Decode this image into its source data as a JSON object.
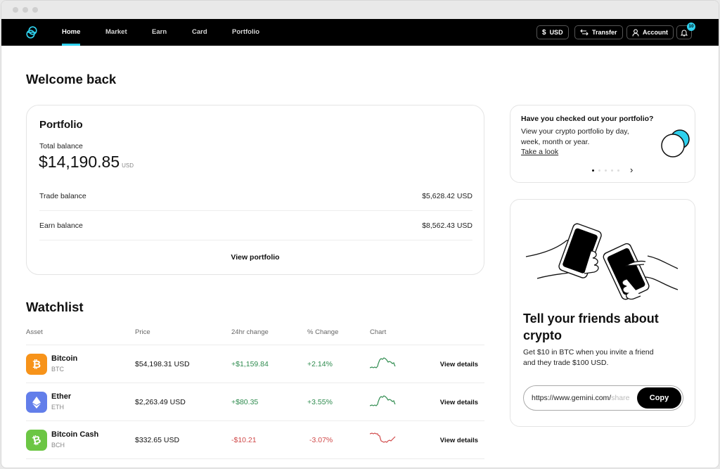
{
  "nav": {
    "logo": "gemini-logo-icon",
    "tabs": [
      {
        "label": "Home",
        "active": true
      },
      {
        "label": "Market",
        "active": false
      },
      {
        "label": "Earn",
        "active": false
      },
      {
        "label": "Card",
        "active": false
      },
      {
        "label": "Portfolio",
        "active": false
      }
    ],
    "currency_label": "USD",
    "transfer_label": "Transfer",
    "account_label": "Account",
    "notification_count": "10",
    "accent_color": "#2fd1ee"
  },
  "welcome": "Welcome back",
  "portfolio": {
    "title": "Portfolio",
    "total_label": "Total balance",
    "total_value": "$14,190.85",
    "total_unit": "USD",
    "rows": [
      {
        "label": "Trade balance",
        "value": "$5,628.42 USD"
      },
      {
        "label": "Earn balance",
        "value": "$8,562.43 USD"
      }
    ],
    "view_label": "View portfolio"
  },
  "watchlist": {
    "title": "Watchlist",
    "columns": [
      "Asset",
      "Price",
      "24hr change",
      "% Change",
      "Chart"
    ],
    "rows": [
      {
        "name": "Bitcoin",
        "symbol": "BTC",
        "icon": "bitcoin-icon",
        "icon_color": "#f7931a",
        "price": "$54,198.31 USD",
        "change": "+$1,159.84",
        "pct": "+2.14%",
        "trend": "up",
        "action": "View details"
      },
      {
        "name": "Ether",
        "symbol": "ETH",
        "icon": "ether-icon",
        "icon_color": "#627eea",
        "price": "$2,263.49 USD",
        "change": "+$80.35",
        "pct": "+3.55%",
        "trend": "up",
        "action": "View details"
      },
      {
        "name": "Bitcoin Cash",
        "symbol": "BCH",
        "icon": "bitcoin-cash-icon",
        "icon_color": "#6cc644",
        "price": "$332.65 USD",
        "change": "-$10.21",
        "pct": "-3.07%",
        "trend": "down",
        "action": "View details"
      }
    ],
    "positive_color": "#2e8b4e",
    "negative_color": "#d04848"
  },
  "promo": {
    "title": "Have you checked out your portfolio?",
    "text": "View your crypto portfolio by day, week, month or year.",
    "link": "Take a look",
    "pages": 5,
    "current_page": 1
  },
  "refer": {
    "title": "Tell your friends about crypto",
    "text": "Get $10 in BTC when you invite a friend and they trade $100 USD.",
    "url_visible": "https://www.gemini.com/",
    "url_faded": "share",
    "copy_label": "Copy"
  }
}
